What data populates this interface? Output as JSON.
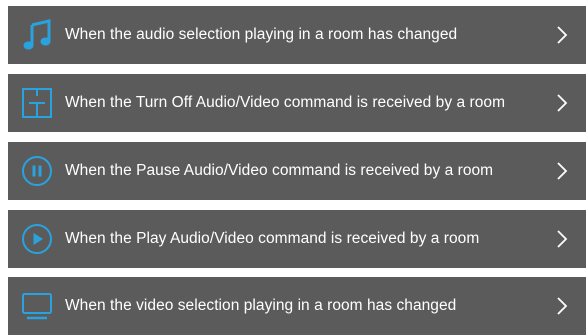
{
  "colors": {
    "row_background": "#5b5b5b",
    "accent": "#29a3df",
    "text": "#ffffff"
  },
  "triggers": [
    {
      "label": "When the audio selection playing in a room has changed",
      "icon": "music-note-icon"
    },
    {
      "label": "When the Turn Off Audio/Video command is received by a room",
      "icon": "room-layout-icon"
    },
    {
      "label": "When the Pause Audio/Video command is received by a room",
      "icon": "pause-circle-icon"
    },
    {
      "label": "When the Play Audio/Video command is received by a room",
      "icon": "play-circle-icon"
    },
    {
      "label": "When the video selection playing in a room has changed",
      "icon": "monitor-icon"
    }
  ]
}
